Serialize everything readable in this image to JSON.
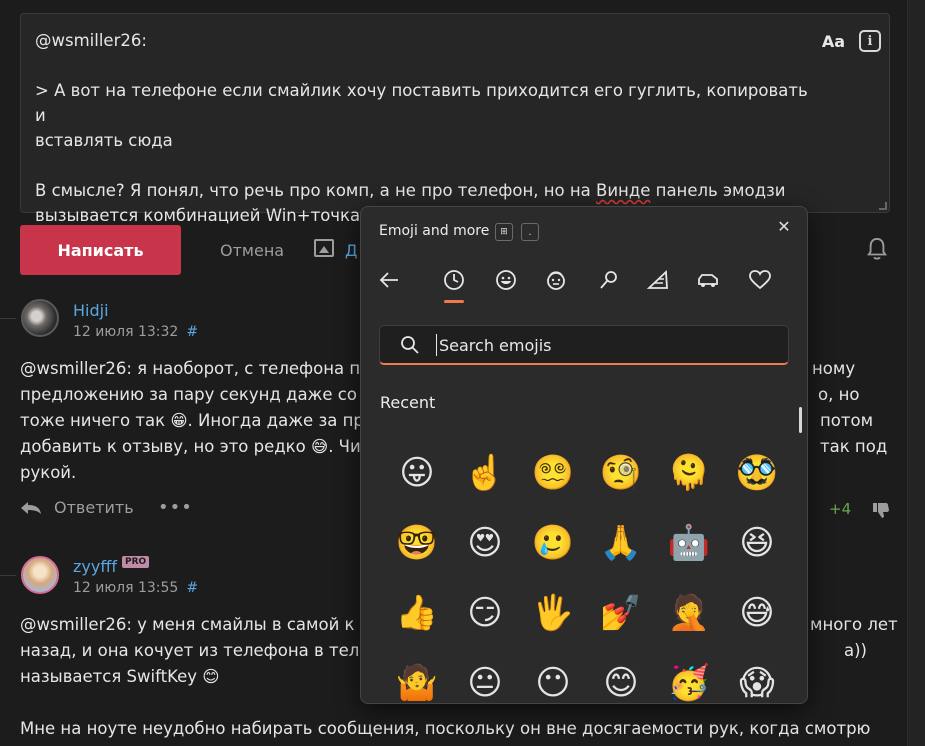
{
  "editor": {
    "lines": [
      "@wsmiller26:",
      "",
      "> А вот на телефоне если смайлик хочу поставить приходится его гуглить, копировать и",
      "вставлять сюда",
      "",
      "В смысле? Я понял, что речь про комп, а не про телефон, но на ",
      "Винде",
      " панель эмодзи",
      "вызывается комбинацией Win+точка."
    ],
    "format_label": "Aa",
    "info_label": "i"
  },
  "actions": {
    "write_label": "Написать",
    "cancel_label": "Отмена",
    "image_label": "Д"
  },
  "comments": [
    {
      "author": "Hidji",
      "date": "12 июля 13:32",
      "hash": "#",
      "lines": [
        "@wsmiller26: я наоборот, с телефона п",
        "предложению за пару секунд даже со с",
        "тоже ничего так 😁. Иногда даже за про",
        "добавить к отзыву, но это редко 😅. Чис",
        "рукой."
      ],
      "right_lines": [
        "ному",
        "о, но",
        "потом",
        "так под",
        ""
      ],
      "reply_label": "Ответить",
      "more_label": "•••",
      "score": "+4"
    },
    {
      "author": "zyyfff",
      "badge": "PRO",
      "date": "12 июля 13:55",
      "hash": "#",
      "lines": [
        "@wsmiller26: у меня смайлы в самой к",
        "назад, и она кочует из телефона в теле",
        "называется SwiftKey 😊",
        "",
        "Мне на ноуте неудобно набирать сообщения, поскольку он вне досягаемости рук, когда смотрю"
      ],
      "right_lines": [
        "много лет",
        "а))",
        "",
        "",
        ""
      ]
    }
  ],
  "emoji_panel": {
    "title": "Emoji and more",
    "win_key": "⊞",
    "period_key": ".",
    "close": "✕",
    "categories": [
      "back",
      "recent",
      "emoji",
      "kaomoji",
      "symbols",
      "gif",
      "transport",
      "favorites"
    ],
    "search_placeholder": "Search emojis",
    "recent_label": "Recent",
    "emojis": [
      [
        "😛",
        "☝️",
        "😵‍💫",
        "🧐",
        "🫠",
        "🥸"
      ],
      [
        "🤓",
        "😍",
        "🥲",
        "🙏",
        "🤖",
        "😆"
      ],
      [
        "👍",
        "😏",
        "🖐️",
        "💅",
        "🤦",
        "😅"
      ],
      [
        "🤷",
        "😐",
        "😶",
        "😊",
        "🥳",
        "😱"
      ]
    ]
  },
  "colors": {
    "accent": "#f07a4a",
    "brand_button": "#c8354a",
    "link": "#5aa6e0",
    "positive": "#67a84e"
  }
}
